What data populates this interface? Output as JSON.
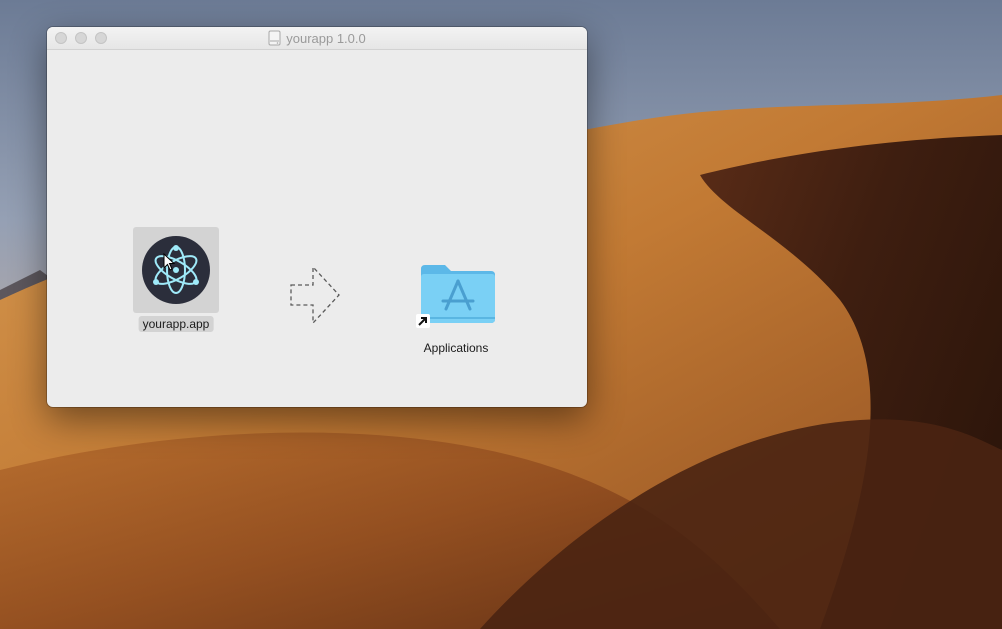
{
  "desktop": {
    "wallpaper": "sand-dunes"
  },
  "window": {
    "title": "yourapp 1.0.0",
    "title_icon": "disk-image-icon",
    "buttons": [
      "close",
      "minimize",
      "zoom"
    ]
  },
  "installer": {
    "app": {
      "label": "yourapp.app",
      "icon": "electron-atom-icon",
      "selected": true
    },
    "arrow": {
      "icon": "dashed-right-arrow-icon"
    },
    "target": {
      "label": "Applications",
      "icon": "applications-folder-icon",
      "alias": true
    }
  },
  "colors": {
    "window_bg": "#ececec",
    "selection": "#d3d3d3",
    "folder": "#6cc5f0",
    "app_icon_bg": "#2b2e3b",
    "app_icon_lines": "#9feaf9"
  }
}
